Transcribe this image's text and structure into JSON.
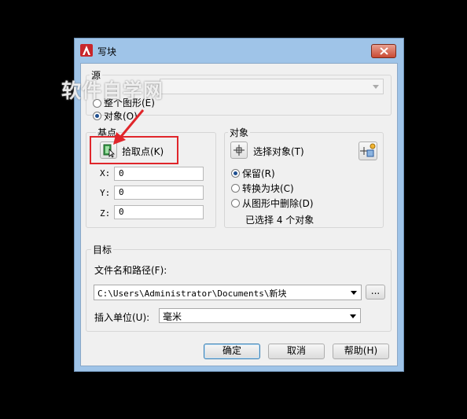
{
  "window": {
    "title": "写块"
  },
  "watermark": "软件自学网",
  "source": {
    "label": "源",
    "options": {
      "block": "块(B)",
      "entire_drawing": "整个图形(E)",
      "objects": "对象(O)"
    },
    "selected": "objects",
    "block_combo_value": ""
  },
  "base_point": {
    "label": "基点",
    "pick_label": "拾取点(K)",
    "x_label": "X:",
    "x_value": "0",
    "y_label": "Y:",
    "y_value": "0",
    "z_label": "Z:",
    "z_value": "0"
  },
  "objects": {
    "label": "对象",
    "select_label": "选择对象(T)",
    "retain": "保留(R)",
    "convert": "转换为块(C)",
    "delete": "从图形中删除(D)",
    "selected": "retain",
    "status": "已选择 4 个对象"
  },
  "destination": {
    "label": "目标",
    "path_label": "文件名和路径(F):",
    "path_value": "C:\\Users\\Administrator\\Documents\\新块",
    "browse_label": "...",
    "units_label": "插入单位(U):",
    "units_value": "毫米"
  },
  "buttons": {
    "ok": "确定",
    "cancel": "取消",
    "help": "帮助(H)"
  },
  "colors": {
    "highlight": "#e0262b",
    "titlebar": "#9fc4e8",
    "close": "#c94a34"
  }
}
